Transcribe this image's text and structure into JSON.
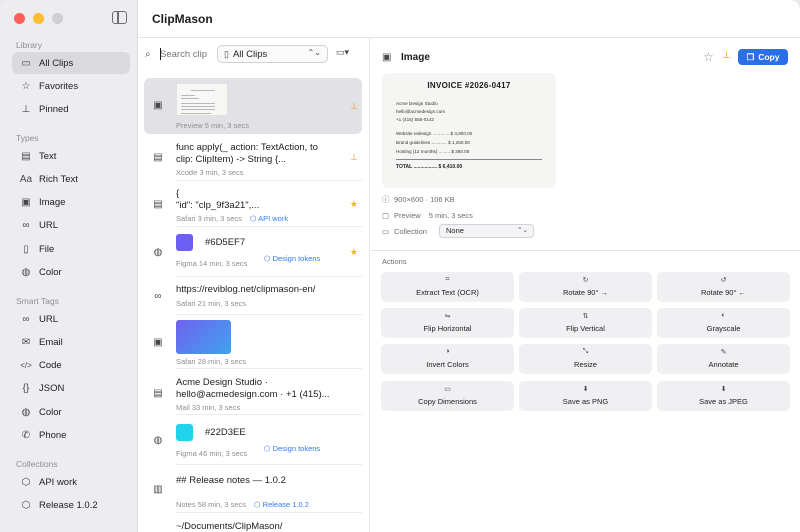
{
  "app": {
    "title": "ClipMason"
  },
  "sidebar": {
    "sections": [
      {
        "label": "Library",
        "items": [
          {
            "label": "All Clips",
            "icon": "tray-icon",
            "glyph": "▭",
            "active": true
          },
          {
            "label": "Favorites",
            "icon": "star-icon",
            "glyph": "☆"
          },
          {
            "label": "Pinned",
            "icon": "pin-icon",
            "glyph": "⊥"
          }
        ]
      },
      {
        "label": "Types",
        "items": [
          {
            "label": "Text",
            "icon": "text-doc-icon",
            "glyph": "▤"
          },
          {
            "label": "Rich Text",
            "icon": "rich-text-icon",
            "glyph": "Aa"
          },
          {
            "label": "Image",
            "icon": "image-icon",
            "glyph": "▣"
          },
          {
            "label": "URL",
            "icon": "link-icon",
            "glyph": "∞"
          },
          {
            "label": "File",
            "icon": "file-icon",
            "glyph": "▯"
          },
          {
            "label": "Color",
            "icon": "palette-icon",
            "glyph": "◍"
          }
        ]
      },
      {
        "label": "Smart Tags",
        "items": [
          {
            "label": "URL",
            "icon": "link-icon",
            "glyph": "∞"
          },
          {
            "label": "Email",
            "icon": "envelope-icon",
            "glyph": "✉"
          },
          {
            "label": "Code",
            "icon": "code-icon",
            "glyph": "</>"
          },
          {
            "label": "JSON",
            "icon": "braces-icon",
            "glyph": "{}"
          },
          {
            "label": "Color",
            "icon": "palette-icon",
            "glyph": "◍"
          },
          {
            "label": "Phone",
            "icon": "phone-icon",
            "glyph": "✆"
          }
        ]
      },
      {
        "label": "Collections",
        "items": [
          {
            "label": "API work",
            "icon": "cube-icon",
            "glyph": "⬡"
          },
          {
            "label": "Release 1.0.2",
            "icon": "cube-icon",
            "glyph": "⬡"
          }
        ]
      }
    ]
  },
  "list": {
    "search_placeholder": "Search clip",
    "filter_label": "All Clips",
    "rows": [
      {
        "kind": "image-invoice",
        "meta": "Preview  5 min, 3 secs",
        "pinned": true,
        "selected": true
      },
      {
        "kind": "text",
        "line1": "func apply(_ action: TextAction, to",
        "line2": "clip: ClipItem) -> String {...",
        "meta": "Xcode  3 min, 3 secs",
        "pinned": true
      },
      {
        "kind": "json",
        "line1": "{",
        "line2": "  \"id\": \"clp_9f3a21\",...",
        "meta": "Safari  3 min, 3 secs",
        "tag": "API work",
        "starred": true
      },
      {
        "kind": "color",
        "line1": "#6D5EF7",
        "meta": "Figma  14 min, 3 secs",
        "tag": "Design tokens",
        "swatch": "#6D5EF7",
        "starred": true
      },
      {
        "kind": "url",
        "line1": "https://reviblog.net/clipmason-en/",
        "meta": "Safari  21 min, 3 secs"
      },
      {
        "kind": "image-gradient",
        "meta": "Safari  28 min, 3 secs"
      },
      {
        "kind": "text",
        "line1": "Acme Design Studio ·",
        "line2": "hello@acmedesign.com · +1 (415)...",
        "meta": "Mail  33 min, 3 secs"
      },
      {
        "kind": "color",
        "line1": "#22D3EE",
        "meta": "Figma  46 min, 3 secs",
        "tag": "Design tokens",
        "swatch": "#22D3EE"
      },
      {
        "kind": "text",
        "line1": "## Release notes — 1.0.2",
        "meta": "Notes  58 min, 3 secs",
        "tag": "Release 1.0.2"
      },
      {
        "kind": "file",
        "line1": "~/Documents/ClipMason/"
      }
    ]
  },
  "detail": {
    "type_label": "Image",
    "copy_label": "Copy",
    "invoice": {
      "title": "INVOICE  #2026-0417",
      "from": [
        "Acme Design Studio",
        "hello@acmedesign.com",
        "+1 (415) 555-0142"
      ],
      "lines": [
        "Website redesign ............. $ 4,800.00",
        "Brand guidelines ............ $ 1,250.00",
        "Hosting (12 months) ......... $   360.00"
      ],
      "total": "TOTAL ................. $ 6,410.00"
    },
    "dimensions": "900×600 · 106 KB",
    "source": "Preview",
    "age": "5 min, 3 secs",
    "collection_label": "Collection",
    "collection_value": "None",
    "actions_label": "Actions",
    "actions": [
      {
        "label": "Extract Text (OCR)",
        "icon": "ocr-icon",
        "glyph": "⌗"
      },
      {
        "label": "Rotate 90° →",
        "icon": "rotate-right-icon",
        "glyph": "↻"
      },
      {
        "label": "Rotate 90° ←",
        "icon": "rotate-left-icon",
        "glyph": "↺"
      },
      {
        "label": "Flip Horizontal",
        "icon": "flip-horizontal-icon",
        "glyph": "⇋"
      },
      {
        "label": "Flip Vertical",
        "icon": "flip-vertical-icon",
        "glyph": "⇅"
      },
      {
        "label": "Grayscale",
        "icon": "grayscale-icon",
        "glyph": "◐"
      },
      {
        "label": "Invert Colors",
        "icon": "invert-icon",
        "glyph": "◑"
      },
      {
        "label": "Resize",
        "icon": "resize-icon",
        "glyph": "⤡"
      },
      {
        "label": "Annotate",
        "icon": "annotate-icon",
        "glyph": "✎"
      },
      {
        "label": "Copy Dimensions",
        "icon": "ruler-icon",
        "glyph": "▭"
      },
      {
        "label": "Save as PNG",
        "icon": "save-png-icon",
        "glyph": "⬇"
      },
      {
        "label": "Save as JPEG",
        "icon": "save-jpeg-icon",
        "glyph": "⬇"
      }
    ]
  }
}
